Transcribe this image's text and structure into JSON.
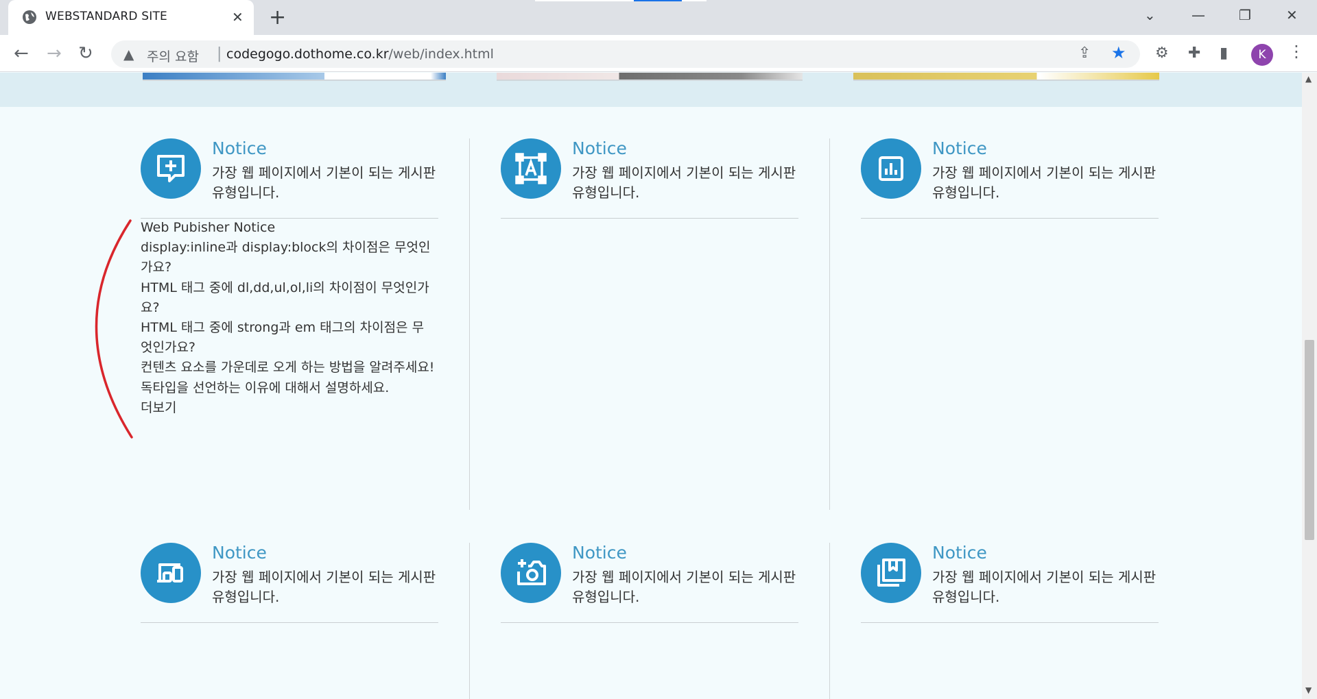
{
  "browser": {
    "tab_title": "WEBSTANDARD SITE",
    "new_tab": "+",
    "close": "✕",
    "security_label": "주의 요함",
    "url_host": "codegogo.dothome.co.kr",
    "url_path": "/web/index.html",
    "profile_initial": "K",
    "window_controls": {
      "minimize": "—",
      "restore": "❐",
      "close": "✕",
      "tab_search": "⌄"
    }
  },
  "notices": [
    {
      "heading": "Notice",
      "desc": "가장 웹 페이지에서 기본이 되는 게시판 유형입니다.",
      "icon": "chat-plus-icon"
    },
    {
      "heading": "Notice",
      "desc": "가장 웹 페이지에서 기본이 되는 게시판 유형입니다.",
      "icon": "text-frame-icon"
    },
    {
      "heading": "Notice",
      "desc": "가장 웹 페이지에서 기본이 되는 게시판 유형입니다.",
      "icon": "bar-chart-icon"
    },
    {
      "heading": "Notice",
      "desc": "가장 웹 페이지에서 기본이 되는 게시판 유형입니다.",
      "icon": "devices-icon"
    },
    {
      "heading": "Notice",
      "desc": "가장 웹 페이지에서 기본이 되는 게시판 유형입니다.",
      "icon": "add-camera-icon"
    },
    {
      "heading": "Notice",
      "desc": "가장 웹 페이지에서 기본이 되는 게시판 유형입니다.",
      "icon": "bookmark-library-icon"
    }
  ],
  "notice_list": {
    "items": [
      "Web Pubisher Notice",
      "display:inline과 display:block의 차이점은 무엇인가요?",
      "HTML 태그 중에 dl,dd,ul,ol,li의 차이점이 무엇인가요?",
      "HTML 태그 중에 strong과 em 태그의 차이점은 무엇인가요?",
      "컨텐츠 요소를 가운데로 오게 하는 방법을 알려주세요!",
      "독타입을 선언하는 이유에 대해서 설명하세요."
    ],
    "more": "더보기"
  },
  "colors": {
    "accent": "#2891c8",
    "heading": "#3f97c4",
    "annotation": "#d9262c",
    "page_bg": "#f3fbfd",
    "band_bg": "#dcedf3"
  }
}
